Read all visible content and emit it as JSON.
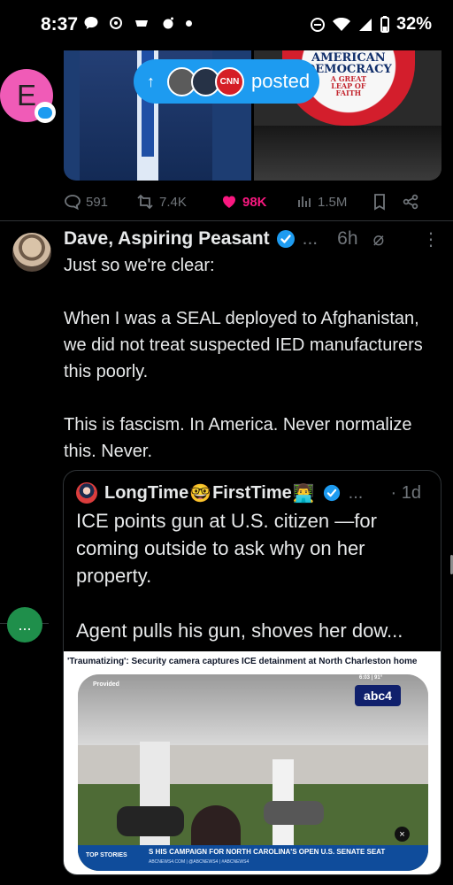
{
  "status_bar": {
    "time": "8:37",
    "battery": "32%"
  },
  "top_post": {
    "posted_label": "posted",
    "badge_text_line1": "AMERICAN",
    "badge_text_line2": "DEMOCRACY",
    "badge_text_line3": "A GREAT",
    "badge_text_line4": "LEAP OF",
    "badge_text_line5": "FAITH",
    "avatar_letter": "E",
    "actions": {
      "replies": "591",
      "reposts": "7.4K",
      "likes": "98K",
      "views": "1.5M"
    }
  },
  "post": {
    "author_name": "Dave, Aspiring Peasant",
    "ellipsis": "...",
    "time": "6h",
    "text": "Just so we're clear:\n\nWhen I was a SEAL deployed to Afghanistan, we did not treat suspected IED manufacturers this poorly.\n\nThis is fascism. In America. Never normalize this. Never.",
    "quote": {
      "author_name_part1": "LongTime",
      "emoji1": "🤓",
      "author_name_part2": "FirstTime",
      "emoji2": "👨‍💻",
      "ellipsis": "...",
      "time": "1d",
      "text": "ICE points gun at U.S. citizen —for coming outside to ask why on her property.\n\nAgent pulls his gun, shoves her dow...",
      "news_headline": "'Traumatizing': Security camera captures ICE detainment at North Charleston home",
      "provided": "Provided",
      "top_stories": "TOP STORIES",
      "ticker": "S HIS CAMPAIGN FOR NORTH CAROLINA'S OPEN U.S. SENATE SEAT",
      "ticker_sub": "ABCNEWS4.COM | @ABCNEWS4 | #ABCNEWS4",
      "station": "abc4",
      "temp": "6:03 | 91°"
    }
  },
  "side_action_label": "...",
  "colors": {
    "background": "#000000",
    "accent": "#1d9bf0",
    "like": "#f91880",
    "muted": "#71767b"
  }
}
